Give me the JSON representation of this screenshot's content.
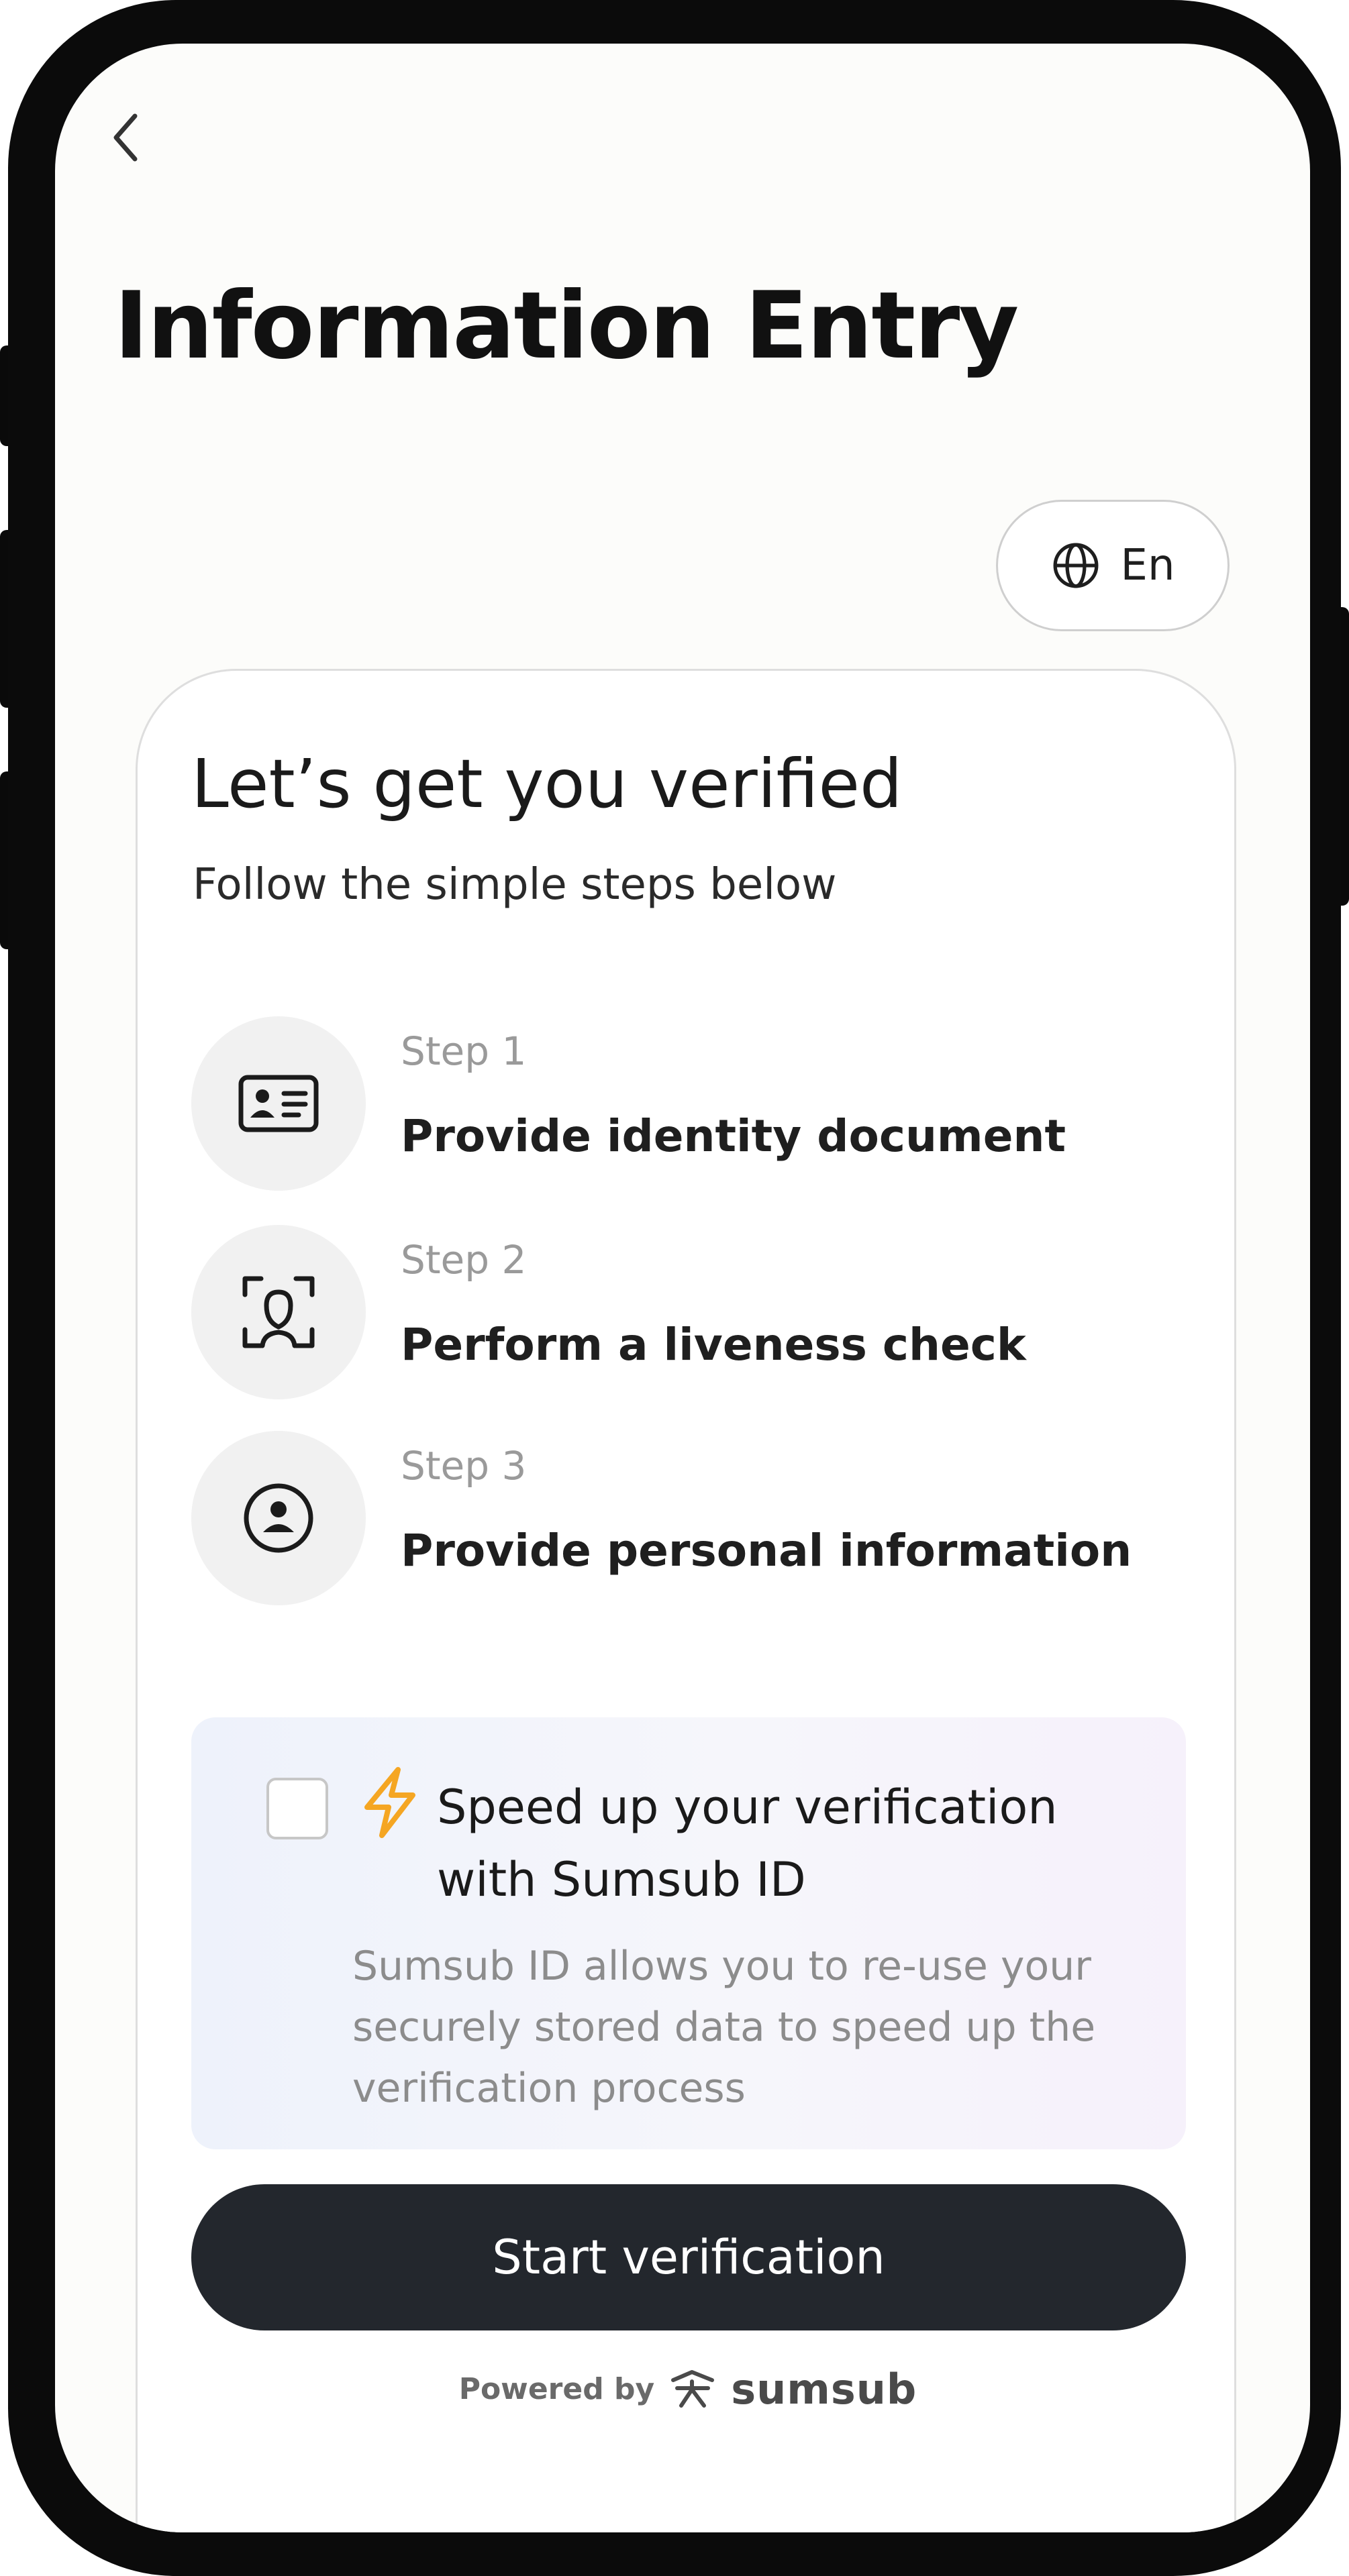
{
  "header": {
    "title": "Information Entry"
  },
  "language": {
    "label": "En"
  },
  "card": {
    "title": "Let’s get you verified",
    "subtitle": "Follow the simple steps below",
    "steps": [
      {
        "number": "Step 1",
        "text": "Provide identity document",
        "icon": "id-card-icon"
      },
      {
        "number": "Step 2",
        "text": "Perform a liveness check",
        "icon": "face-scan-icon"
      },
      {
        "number": "Step 3",
        "text": "Provide personal information",
        "icon": "user-circle-icon"
      }
    ]
  },
  "promo": {
    "title": "Speed up your verification with Sumsub ID",
    "description": "Sumsub ID allows you to re-use your securely stored data to speed up the verification process",
    "checked": false
  },
  "actions": {
    "start_label": "Start verification"
  },
  "footer": {
    "powered_by": "Powered by",
    "brand": "sumsub"
  },
  "colors": {
    "button_bg": "#23272d",
    "bolt": "#f5a623",
    "frame": "#0b0b0b"
  }
}
